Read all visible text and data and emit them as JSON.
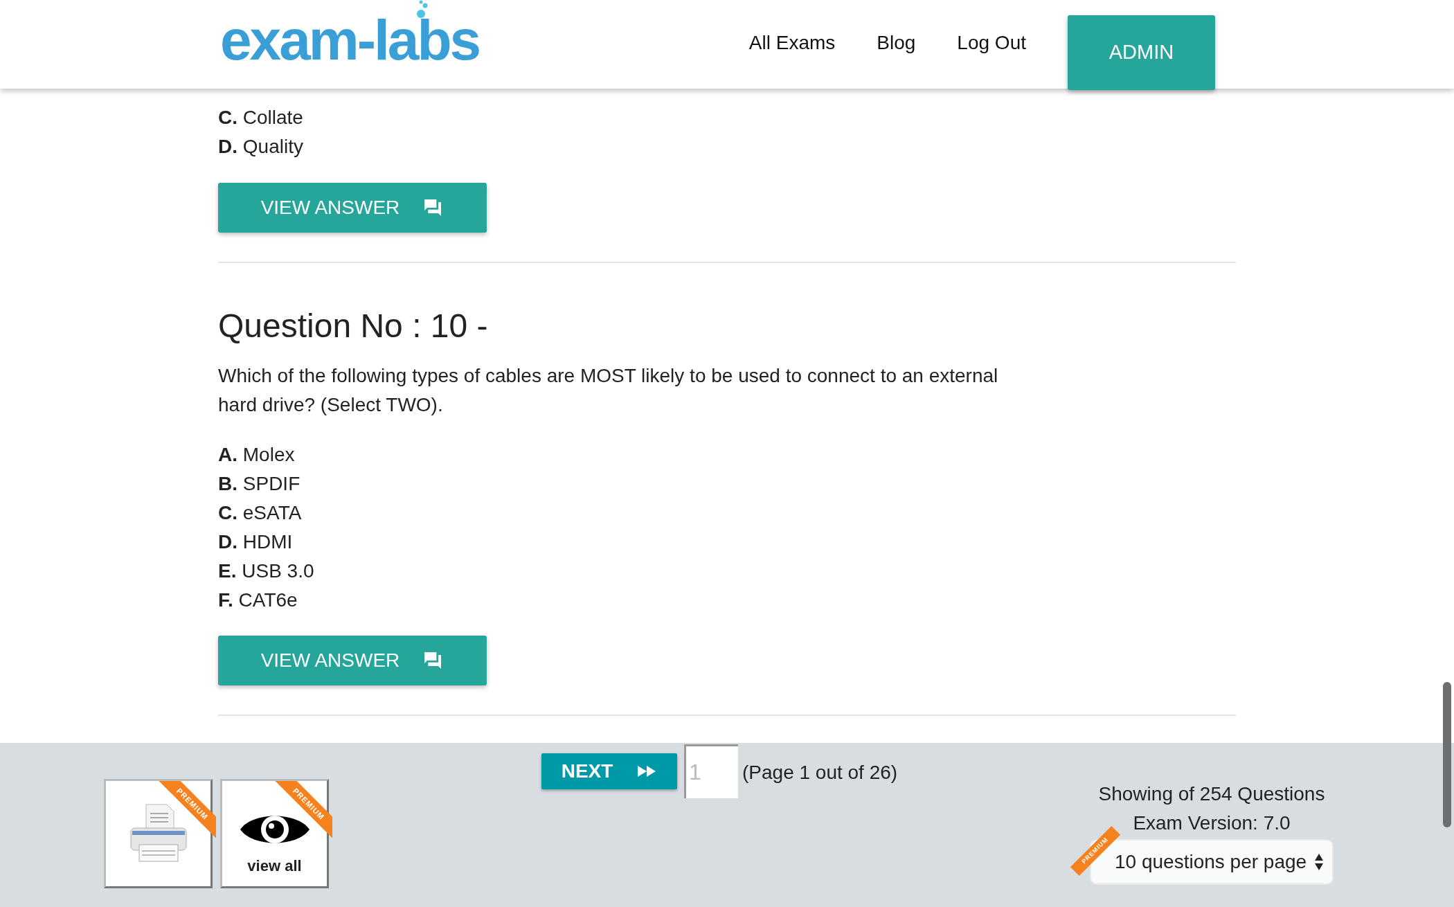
{
  "header": {
    "logo": "exam-labs",
    "nav": [
      "All Exams",
      "Blog",
      "Log Out"
    ],
    "admin_button": "ADMIN"
  },
  "previous_question": {
    "options": [
      {
        "letter": "C.",
        "text": "Collate"
      },
      {
        "letter": "D.",
        "text": "Quality"
      }
    ],
    "view_answer": "VIEW ANSWER"
  },
  "question": {
    "title": "Question No : 10 -",
    "text": "Which of the following types of cables are MOST likely to be used to connect to an external hard drive? (Select TWO).",
    "options": [
      {
        "letter": "A.",
        "text": "Molex"
      },
      {
        "letter": "B.",
        "text": "SPDIF"
      },
      {
        "letter": "C.",
        "text": "eSATA"
      },
      {
        "letter": "D.",
        "text": "HDMI"
      },
      {
        "letter": "E.",
        "text": "USB 3.0"
      },
      {
        "letter": "F.",
        "text": "CAT6e"
      }
    ],
    "view_answer": "VIEW ANSWER"
  },
  "footer": {
    "tools": [
      {
        "kind": "print",
        "badge": "PREMIUM"
      },
      {
        "kind": "view",
        "badge": "PREMIUM",
        "label": "view all"
      }
    ],
    "next_button": "NEXT",
    "page_input": {
      "placeholder": "1"
    },
    "page_info": "(Page 1 out of 26)",
    "showing": "Showing of 254 Questions",
    "version": "Exam Version: 7.0",
    "per_page": {
      "value": "10 questions per page",
      "badge": "PREMIUM"
    }
  }
}
